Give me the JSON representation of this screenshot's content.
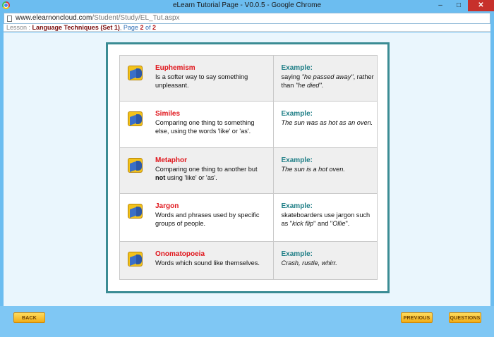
{
  "window": {
    "title": "eLearn Tutorial Page - V0.0.5 - Google Chrome",
    "minimize": "–",
    "maximize": "□",
    "close": "✕"
  },
  "address": {
    "host": "www.elearnoncloud.com",
    "path": "/Student/Study/EL_Tut.aspx"
  },
  "lesson": {
    "label": "Lesson : ",
    "name": "Language Techniques (Set 1)",
    "sep": ", ",
    "page_word": "Page ",
    "page": "2",
    "of_word": " of ",
    "total": "2"
  },
  "terms": [
    {
      "term": "Euphemism",
      "def": "Is a softer way to say something unpleasant."
    },
    {
      "term": "Similes",
      "def": "Comparing one thing to something else, using the words 'like' or 'as'."
    },
    {
      "term": "Metaphor",
      "def_a": "Comparing one thing to another but ",
      "def_b": "not",
      "def_c": " using 'like' or 'as'."
    },
    {
      "term": "Jargon",
      "def": "Words and phrases used by specific groups of people."
    },
    {
      "term": "Onomatopoeia",
      "def": "Words which sound like themselves."
    }
  ],
  "examples": [
    {
      "label": "Example:",
      "a": "saying ",
      "b": "\"he passed away\"",
      "c": ", rather than ",
      "d": "\"he died\"",
      "e": "."
    },
    {
      "label": "Example:",
      "text": "The sun was as hot as an oven."
    },
    {
      "label": "Example:",
      "text": "The sun is a hot oven."
    },
    {
      "label": "Example:",
      "a": "skateboarders use jargon such as \"",
      "b": "kick flip",
      "c": "\" and \"",
      "d": "Ollie",
      "e": "\"."
    },
    {
      "label": "Example:",
      "text": "Crash, rustle, whirr."
    }
  ],
  "nav": {
    "back": "BACK",
    "previous": "PREVIOUS",
    "questions": "QUESTIONS"
  },
  "colors": {
    "term": "#e0151b",
    "example_label": "#1e7e86",
    "frame": "#3b8c94",
    "bar": "#7fc7f4"
  }
}
